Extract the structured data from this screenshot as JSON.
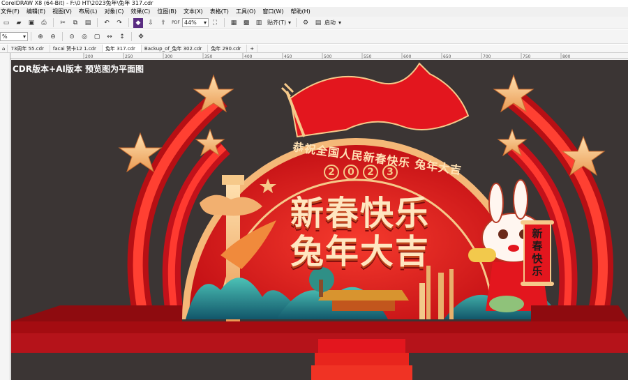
{
  "window": {
    "title": "CorelDRAW X8 (64-Bit) - F:\\0 HT\\2023兔年\\兔年 317.cdr"
  },
  "menu": [
    "文件(F)",
    "编辑(E)",
    "视图(V)",
    "布局(L)",
    "对象(C)",
    "效果(C)",
    "位图(B)",
    "文本(X)",
    "表格(T)",
    "工具(O)",
    "窗口(W)",
    "帮助(H)"
  ],
  "toolbar": {
    "zoom_value": "44%",
    "snap_label": "贴齐(T)",
    "launch_label": "启动"
  },
  "propbar": {
    "zoom_combo": "%"
  },
  "tabs": [
    "73周年 55.cdr",
    "facai 贺卡12 1.cdr",
    "兔年 317.cdr",
    "Backup_of_兔年 302.cdr",
    "兔年 290.cdr"
  ],
  "active_tab": 2,
  "ruler": {
    "ticks": [
      "200",
      "250",
      "300",
      "350",
      "400",
      "450",
      "500",
      "550",
      "600",
      "650",
      "700",
      "750",
      "800"
    ]
  },
  "canvas": {
    "overlay_label": "CDR版本+AI版本 预览图为平面图",
    "arch_text": "恭祝全国人民新春快乐 兔年大吉",
    "year_chars": [
      "2",
      "0",
      "2",
      "3"
    ],
    "headline_1": "新春快乐",
    "headline_2": "兔年大吉",
    "scroll_text": "新春快乐"
  },
  "colors": {
    "canvas_bg": "#3b3534",
    "red": "#e31b23",
    "dark_red": "#a80d12",
    "gold": "#f6c98a",
    "teal": "#2aa7a0"
  }
}
